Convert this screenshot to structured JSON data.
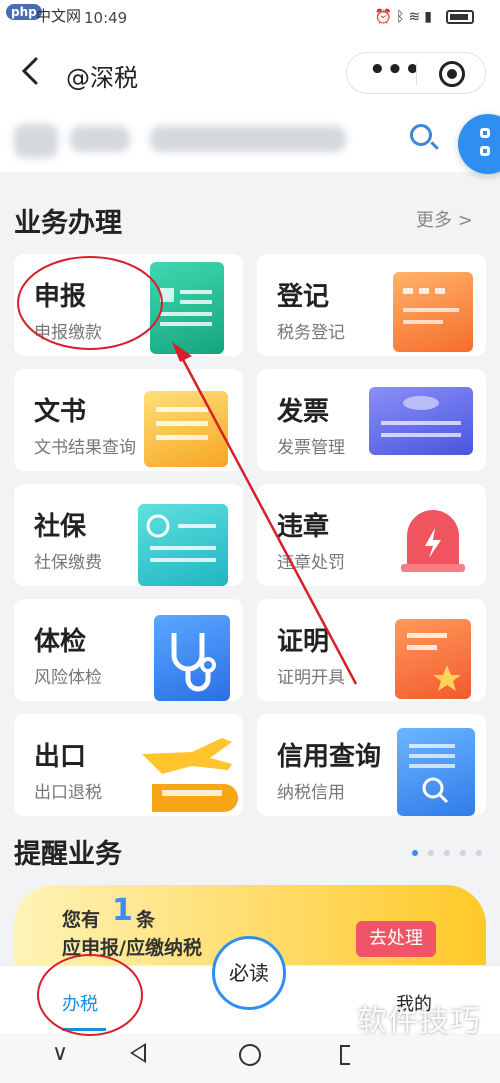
{
  "status_bar": {
    "watermark_logo": "php",
    "watermark_text": "中文网",
    "time": "10:49"
  },
  "header": {
    "back_icon": "chevron-left-icon",
    "title": "@深税",
    "menu_icon": "more-dots-icon",
    "close_icon": "target-icon"
  },
  "search": {
    "icon": "search-icon"
  },
  "business": {
    "title": "业务办理",
    "more": "更多 >",
    "items": [
      {
        "name": "申报",
        "sub": "申报缴款",
        "icon": "declaration-form-icon"
      },
      {
        "name": "登记",
        "sub": "税务登记",
        "icon": "registration-form-icon"
      },
      {
        "name": "文书",
        "sub": "文书结果查询",
        "icon": "document-stack-icon"
      },
      {
        "name": "发票",
        "sub": "发票管理",
        "icon": "invoice-icon"
      },
      {
        "name": "社保",
        "sub": "社保缴费",
        "icon": "social-security-card-icon"
      },
      {
        "name": "违章",
        "sub": "违章处罚",
        "icon": "alarm-bell-icon"
      },
      {
        "name": "体检",
        "sub": "风险体检",
        "icon": "stethoscope-icon"
      },
      {
        "name": "证明",
        "sub": "证明开具",
        "icon": "certificate-icon"
      },
      {
        "name": "出口",
        "sub": "出口退税",
        "icon": "export-plane-train-icon"
      },
      {
        "name": "信用查询",
        "sub": "纳税信用",
        "icon": "credit-scroll-search-icon"
      }
    ]
  },
  "reminders": {
    "title": "提醒业务",
    "banner": {
      "prefix": "您有",
      "count": "1",
      "suffix": "条",
      "line2": "应申报/应缴纳税",
      "action": "去处理"
    }
  },
  "tabbar": {
    "tab1": "办税",
    "center": "必读",
    "tab3": "我的"
  },
  "watermark_bottom": "软件技巧"
}
